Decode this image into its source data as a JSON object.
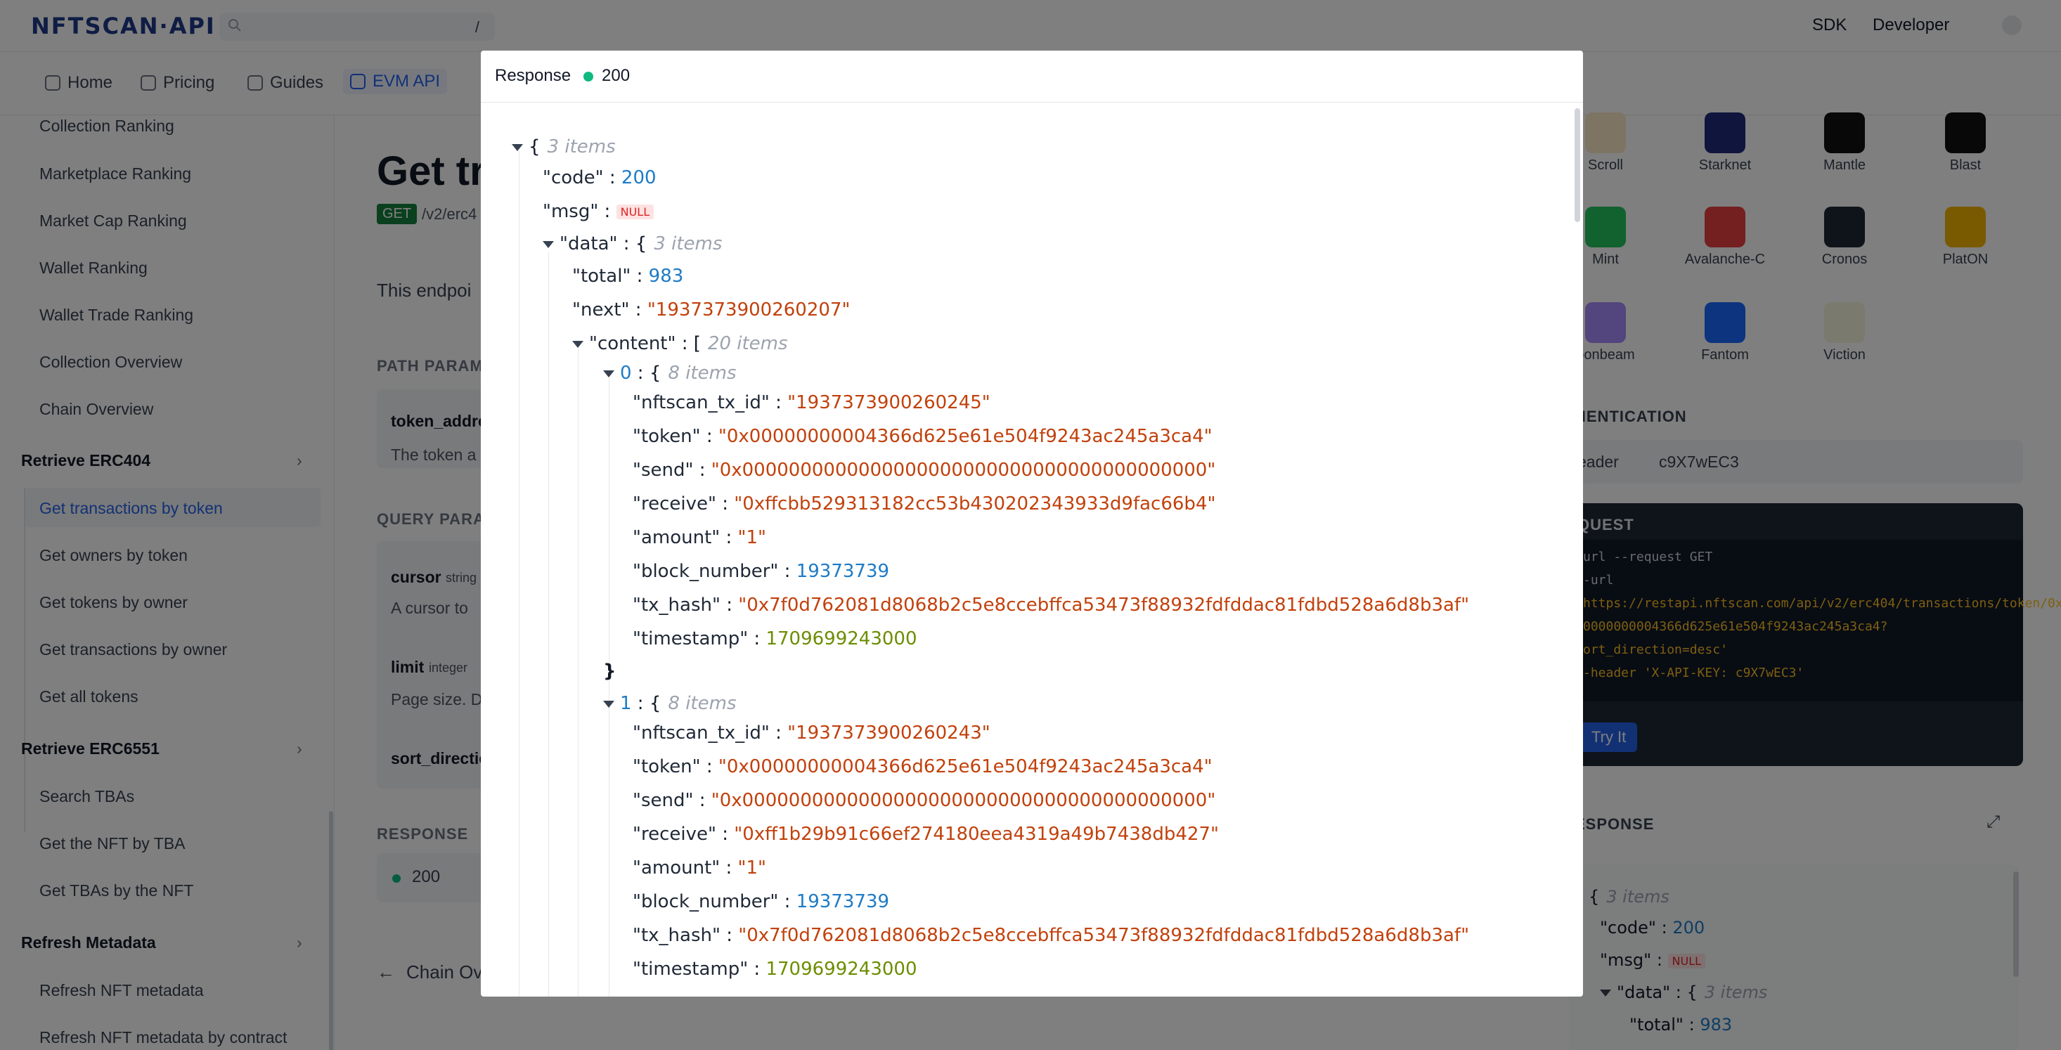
{
  "header": {
    "logo": "NFTSCAN·API",
    "search_shortcut": "/",
    "links": [
      "SDK",
      "Developer"
    ]
  },
  "tabs": [
    {
      "label": "Home",
      "icon": "home-icon"
    },
    {
      "label": "Pricing",
      "icon": "tag-icon"
    },
    {
      "label": "Guides",
      "icon": "diamond-icon"
    },
    {
      "label": "EVM API",
      "icon": "api-icon"
    }
  ],
  "sidebar": {
    "items_top": [
      "Collection Ranking",
      "Marketplace Ranking",
      "Market Cap Ranking",
      "Wallet Ranking",
      "Wallet Trade Ranking",
      "Collection Overview",
      "Chain Overview"
    ],
    "group1": "Retrieve ERC404",
    "group1_items": [
      "Get transactions by token",
      "Get owners by token",
      "Get tokens by owner",
      "Get transactions by owner",
      "Get all tokens"
    ],
    "group2": "Retrieve ERC6551",
    "group2_items": [
      "Search TBAs",
      "Get the NFT by TBA",
      "Get TBAs by the NFT"
    ],
    "group3": "Refresh Metadata",
    "group3_items": [
      "Refresh NFT metadata",
      "Refresh NFT metadata by contract"
    ]
  },
  "main": {
    "title": "Get tra",
    "method": "GET",
    "endpoint": "/v2/erc4",
    "desc": "This endpoi",
    "path_params": "PATH PARAMS",
    "token_addr": "token_addre",
    "token_desc": "The token a",
    "query_params": "QUERY PARAM",
    "cursor": "cursor",
    "cursor_type": "string",
    "cursor_desc": "A cursor to",
    "limit": "limit",
    "limit_type": "integer",
    "limit_desc": "Page size. D",
    "sort": "sort_directio",
    "response": "RESPONSE",
    "resp_code": "200",
    "back": "Chain Ov"
  },
  "right": {
    "chains": [
      "Scroll",
      "Starknet",
      "Mantle",
      "Blast",
      "Mint",
      "Avalanche-C",
      "Cronos",
      "PlatON",
      "oonbeam",
      "Fantom",
      "Viction"
    ],
    "auth": "HENTICATION",
    "auth_header": "eader",
    "auth_key": "c9X7wEC3",
    "request": "QUEST",
    "code": [
      "url --request GET",
      "-url",
      "https://restapi.nftscan.com/api/v2/erc404/transactions/token/0x",
      "0000000004366d625e61e504f9243ac245a3ca4?",
      "ort_direction=desc'",
      "-header 'X-API-KEY: c9X7wEC3'"
    ],
    "try": "Try It",
    "response": "ESPONSE",
    "mini_items": "3 items",
    "mini_code": "200",
    "mini_total": "983"
  },
  "modal": {
    "title": "Response",
    "status": "200",
    "root_count": "3 items",
    "code": "200",
    "msg": "NULL",
    "data_count": "3 items",
    "total": "983",
    "next": "\"1937373900260207\"",
    "content_count": "20 items",
    "items": [
      {
        "index": "0",
        "count": "8 items",
        "nftscan_tx_id": "\"1937373900260245\"",
        "token": "\"0x00000000004366d625e61e504f9243ac245a3ca4\"",
        "send": "\"0x0000000000000000000000000000000000000000\"",
        "receive": "\"0xffcbb529313182cc53b430202343933d9fac66b4\"",
        "amount": "\"1\"",
        "block_number": "19373739",
        "tx_hash": "\"0x7f0d762081d8068b2c5e8ccebffca53473f88932fdfddac81fdbd528a6d8b3af\"",
        "timestamp": "1709699243000"
      },
      {
        "index": "1",
        "count": "8 items",
        "nftscan_tx_id": "\"1937373900260243\"",
        "token": "\"0x00000000004366d625e61e504f9243ac245a3ca4\"",
        "send": "\"0x0000000000000000000000000000000000000000\"",
        "receive": "\"0xff1b29b91c66ef274180eea4319a49b7438db427\"",
        "amount": "\"1\"",
        "block_number": "19373739",
        "tx_hash": "\"0x7f0d762081d8068b2c5e8ccebffca53473f88932fdfddac81fdbd528a6d8b3af\"",
        "timestamp": "1709699243000"
      }
    ]
  },
  "colors": {
    "accent": "#2563eb",
    "status_ok": "#10b981",
    "string": "#c2410c",
    "number": "#1d7bc7",
    "timestamp": "#6b8e00"
  }
}
